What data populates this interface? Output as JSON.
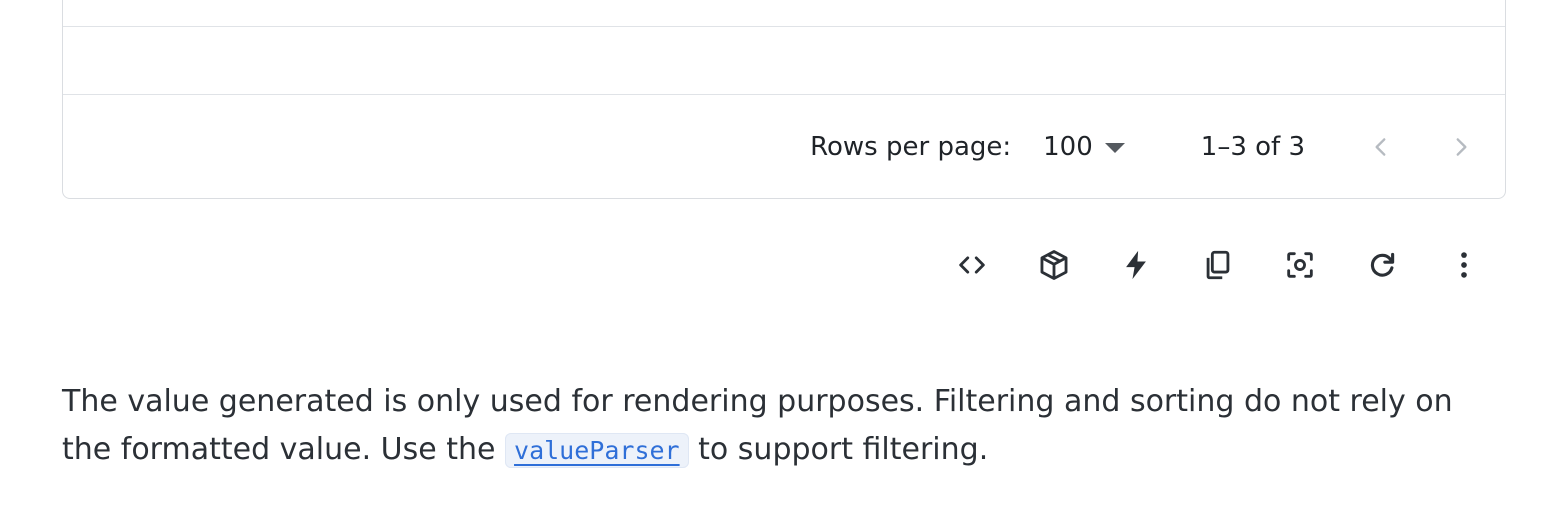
{
  "pagination": {
    "rows_per_page_label": "Rows per page:",
    "rows_per_page_value": "100",
    "range_text": "1–3 of 3"
  },
  "toolbar": {
    "icons": [
      "code-icon",
      "cube-icon",
      "lightning-icon",
      "copy-icon",
      "screenshot-icon",
      "refresh-icon",
      "more-vert-icon"
    ]
  },
  "description": {
    "text_before": "The value generated is only used for rendering purposes. Filtering and sorting do not rely on the formatted value. Use the ",
    "code_link": "valueParser",
    "text_after": " to support filtering."
  },
  "colors": {
    "link": "#2f6fd8",
    "border": "#dadde1"
  }
}
